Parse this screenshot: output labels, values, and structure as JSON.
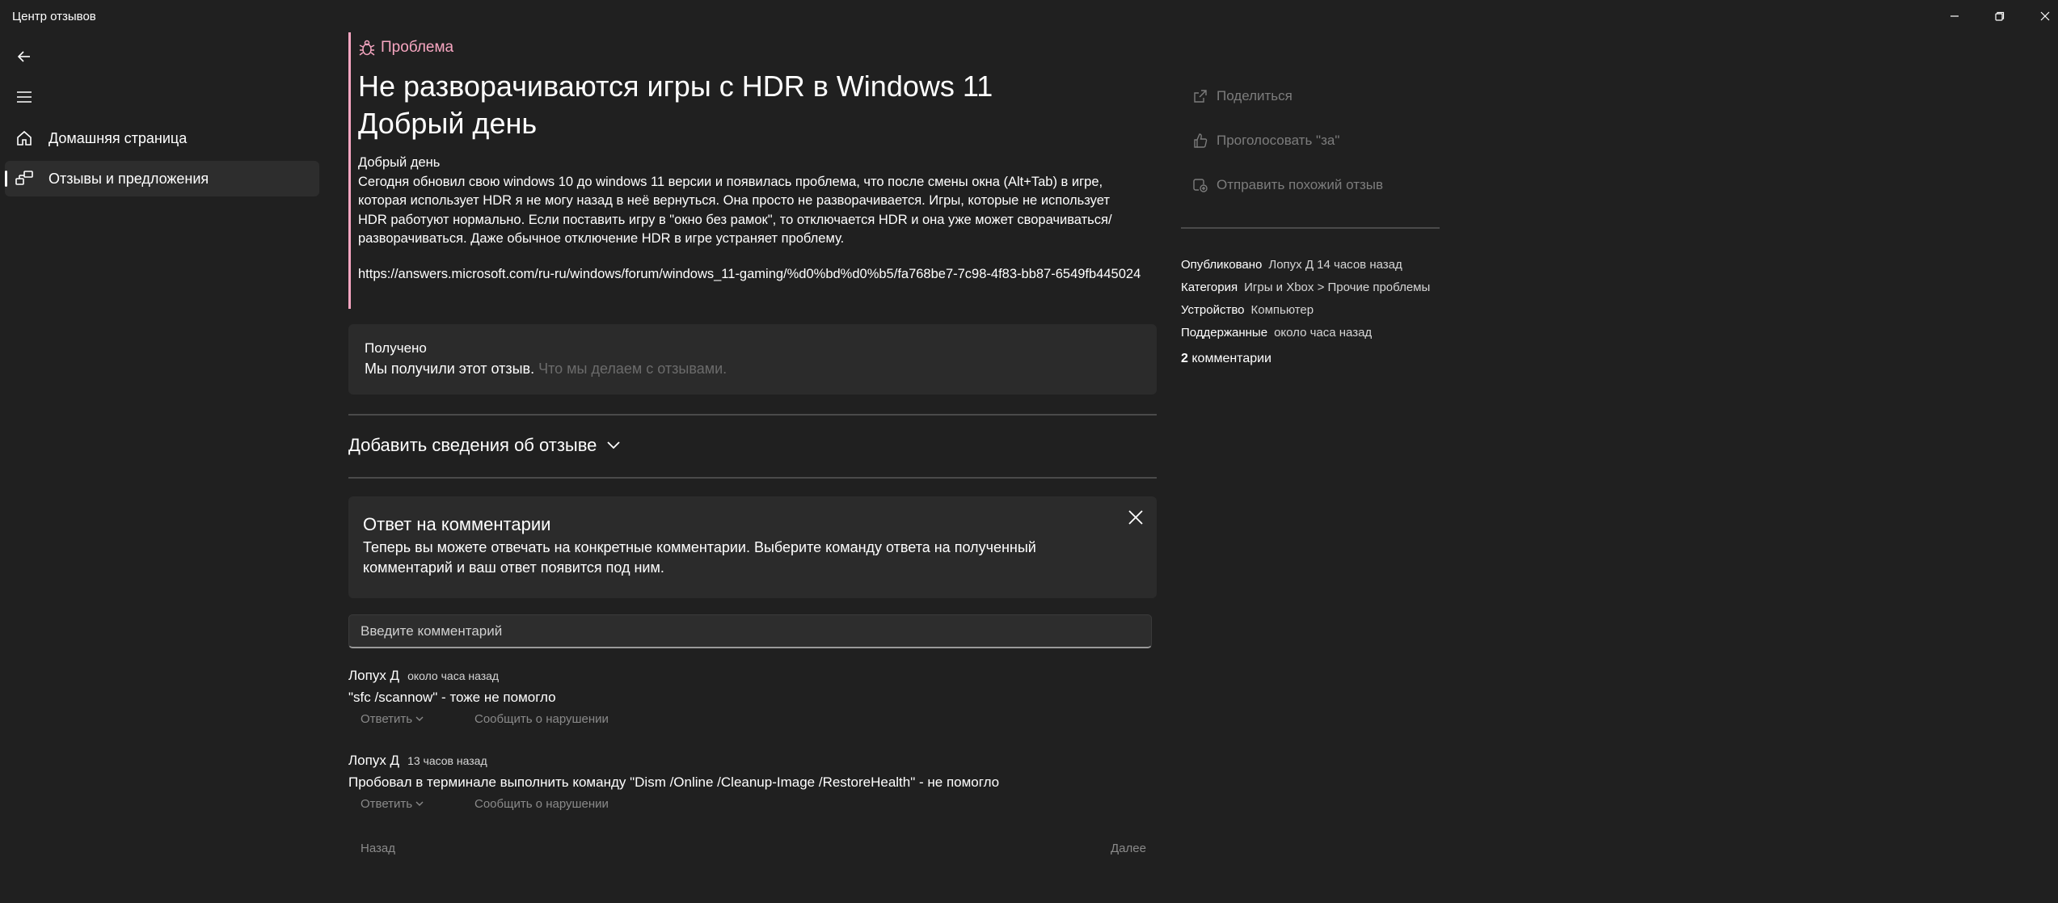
{
  "window": {
    "title": "Центр отзывов",
    "minimize_icon": "minimize-icon",
    "restore_icon": "restore-icon",
    "close_icon": "close-icon"
  },
  "nav": {
    "back_icon": "back-arrow-icon",
    "menu_icon": "hamburger-menu-icon",
    "items": [
      {
        "label": "Домашняя страница",
        "icon": "home-icon",
        "active": false
      },
      {
        "label": "Отзывы и предложения",
        "icon": "feedback-icon",
        "active": true
      }
    ]
  },
  "feedback": {
    "type_label": "Проблема",
    "type_color": "#f7a6c1",
    "title_line1": "Не разворачиваются игры с HDR в Windows 11",
    "title_line2": "Добрый день",
    "body_greeting": "Добрый день",
    "body": "Сегодня обновил свою windows 10 до windows 11 версии и появилась проблема, что после смены окна (Alt+Tab) в игре,\nкоторая использует HDR я не могу назад в неё вернуться. Она просто не разворачивается. Игры, которые не использует\nHDR работуют нормально. Если поставить игру в \"окно без рамок\", то отключается HDR и она уже может сворачиваться/\nразворачиваться. Даже обычное отключение HDR в игре устраняет проблему.",
    "link": "https://answers.microsoft.com/ru-ru/windows/forum/windows_11-gaming/%d0%bd%d0%b5/fa768be7-7c98-4f83-bb87-6549fb445024"
  },
  "received": {
    "heading": "Получено",
    "text": "Мы получили этот отзыв.",
    "link_text": "Что мы делаем с отзывами."
  },
  "add_details": {
    "label": "Добавить сведения об отзыве"
  },
  "info_banner": {
    "heading": "Ответ на комментарии",
    "text": "Теперь вы можете отвечать на конкретные комментарии. Выберите команду ответа на полученный комментарий и ваш ответ появится под ним."
  },
  "comment_input": {
    "placeholder": "Введите комментарий"
  },
  "comments": [
    {
      "author": "Лопух Д",
      "time": "около часа назад",
      "text": "\"sfc /scannow\" - тоже не помогло",
      "reply_label": "Ответить",
      "report_label": "Сообщить о нарушении"
    },
    {
      "author": "Лопух Д",
      "time": "13 часов назад",
      "text": "Пробовал в терминале выполнить команду \"Dism /Online /Cleanup-Image /RestoreHealth\" - не помогло",
      "reply_label": "Ответить",
      "report_label": "Сообщить о нарушении"
    }
  ],
  "pager": {
    "prev": "Назад",
    "next": "Далее"
  },
  "sidebar": {
    "actions": [
      {
        "label": "Поделиться",
        "icon": "share-icon"
      },
      {
        "label": "Проголосовать \"за\"",
        "icon": "thumbs-up-icon"
      },
      {
        "label": "Отправить похожий отзыв",
        "icon": "similar-feedback-icon"
      }
    ],
    "details": [
      {
        "key": "Опубликовано",
        "value": "Лопух Д 14 часов назад"
      },
      {
        "key": "Категория",
        "value": "Игры и Xbox > Прочие проблемы"
      },
      {
        "key": "Устройство",
        "value": "Компьютер"
      },
      {
        "key": "Поддержанные",
        "value": "около часа назад"
      }
    ],
    "comments_count": "2",
    "comments_label": "комментарии"
  }
}
